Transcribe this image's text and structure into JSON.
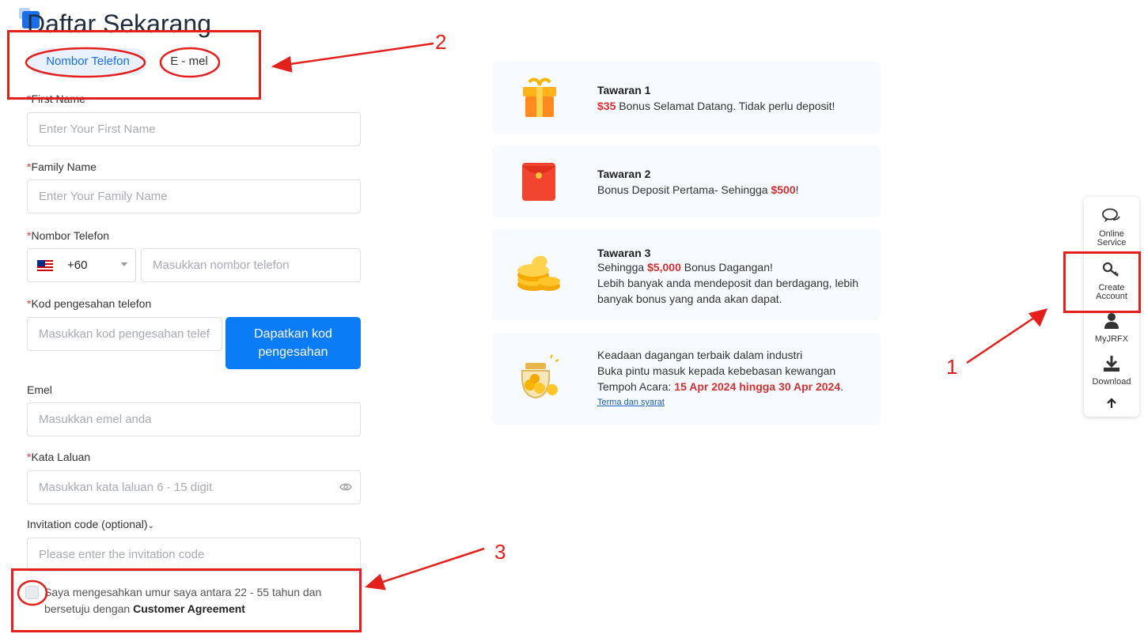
{
  "page": {
    "title": "Daftar Sekarang"
  },
  "tabs": [
    {
      "label": "Nombor Telefon"
    },
    {
      "label": "E - mel"
    }
  ],
  "form": {
    "first_name": {
      "label": "First Name",
      "placeholder": "Enter Your First Name"
    },
    "family_name": {
      "label": "Family Name",
      "placeholder": "Enter Your Family Name"
    },
    "phone": {
      "label": "Nombor Telefon",
      "country_code": "+60",
      "placeholder": "Masukkan nombor telefon"
    },
    "verify_code": {
      "label": "Kod pengesahan telefon",
      "placeholder": "Masukkan kod pengesahan telefon",
      "button": "Dapatkan kod pengesahan"
    },
    "email": {
      "label": "Emel",
      "placeholder": "Masukkan emel anda"
    },
    "password": {
      "label": "Kata Laluan",
      "placeholder": "Masukkan kata laluan 6 - 15 digit"
    },
    "invitation": {
      "label": "Invitation code (optional)",
      "placeholder": "Please enter the invitation code"
    },
    "agreement": {
      "text": "Saya mengesahkan umur saya antara 22 - 55 tahun dan bersetuju dengan ",
      "link": "Customer Agreement"
    }
  },
  "offers": [
    {
      "title": "Tawaran 1",
      "amount": "$35",
      "text": " Bonus Selamat Datang. Tidak perlu deposit!"
    },
    {
      "title": "Tawaran 2",
      "text": "Bonus Deposit Pertama- Sehingga ",
      "amount": "$500",
      "suffix": "!"
    },
    {
      "title": "Tawaran 3",
      "prefix": "Sehingga ",
      "amount": "$5,000",
      "text": " Bonus Dagangan!",
      "line2": "Lebih banyak anda mendeposit dan berdagang, lebih",
      "line3": "banyak bonus yang anda akan dapat."
    },
    {
      "line1": "Keadaan dagangan terbaik dalam industri",
      "line2": "Buka pintu masuk kepada kebebasan kewangan",
      "period_label": "Tempoh Acara: ",
      "period": "15 Apr 2024 hingga 30 Apr 2024",
      "period_end": ".",
      "terms": "Terma dan syarat"
    }
  ],
  "sidebar": {
    "online_service": [
      "Online",
      "Service"
    ],
    "create_account": [
      "Create",
      "Account"
    ],
    "myjrfx": "MyJRFX",
    "download": "Download"
  },
  "annotations": {
    "one": "1",
    "two": "2",
    "three": "3"
  },
  "colors": {
    "primary": "#0a7cf5",
    "highlight": "#d32f2f",
    "annotation": "#e3201b"
  }
}
